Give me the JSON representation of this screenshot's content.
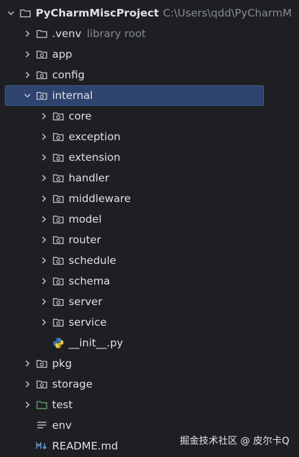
{
  "project": {
    "name": "PyCharmMiscProject",
    "path": "C:\\Users\\qdd\\PyCharmM"
  },
  "items": [
    {
      "label": ".venv",
      "hint": "library root"
    },
    {
      "label": "app"
    },
    {
      "label": "config"
    },
    {
      "label": "internal"
    },
    {
      "label": "core"
    },
    {
      "label": "exception"
    },
    {
      "label": "extension"
    },
    {
      "label": "handler"
    },
    {
      "label": "middleware"
    },
    {
      "label": "model"
    },
    {
      "label": "router"
    },
    {
      "label": "schedule"
    },
    {
      "label": "schema"
    },
    {
      "label": "server"
    },
    {
      "label": "service"
    },
    {
      "label": "__init__.py"
    },
    {
      "label": "pkg"
    },
    {
      "label": "storage"
    },
    {
      "label": "test"
    },
    {
      "label": "env"
    },
    {
      "label": "README.md"
    }
  ],
  "watermark": "掘金技术社区 @ 皮尔卡Q",
  "colors": {
    "background": "#1e1f22",
    "selection": "#2e436e",
    "text": "#dfe1e5",
    "hint": "#868a91",
    "test_folder": "#5f9e6c",
    "python_blue": "#3d7ab8",
    "python_yellow": "#f2c93b",
    "markdown": "#6b9bd8"
  }
}
